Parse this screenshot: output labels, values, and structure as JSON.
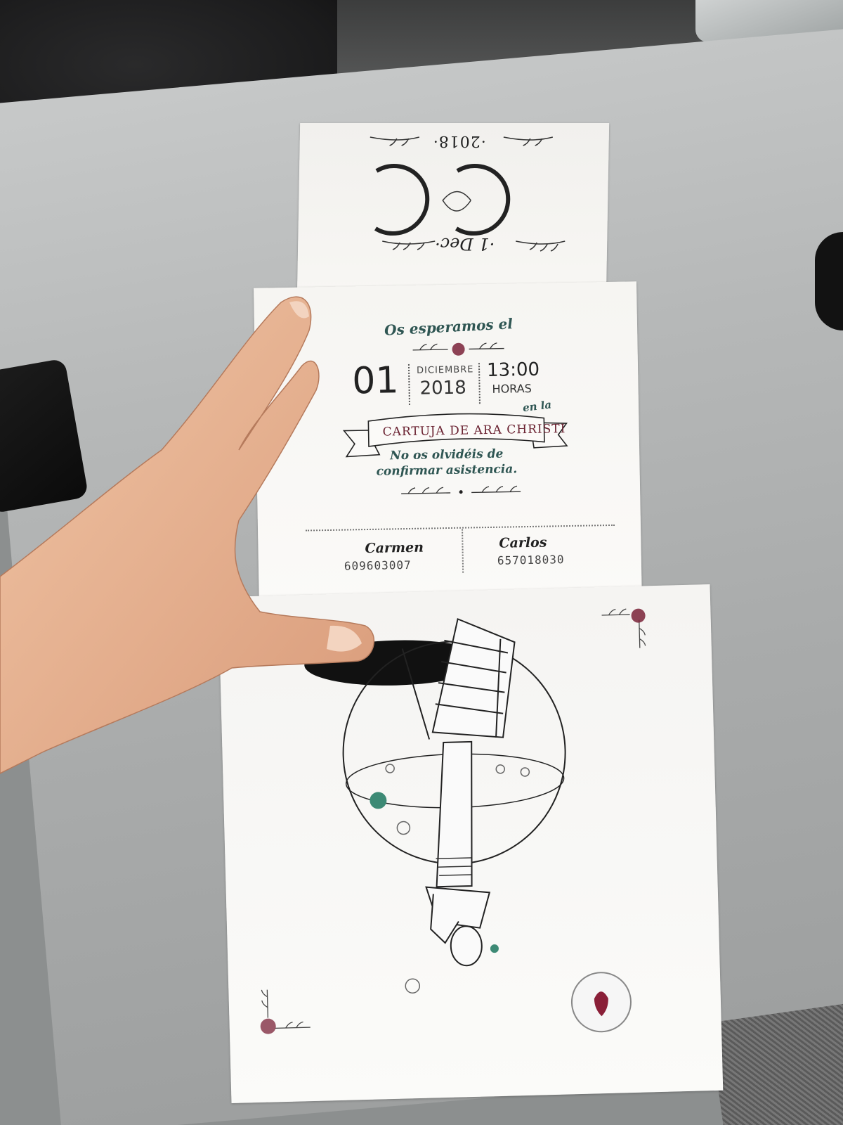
{
  "monogram_panel": {
    "year": "·2018·",
    "letters": "CC",
    "date_short": "·1 Dec·"
  },
  "details_panel": {
    "heading": "Os esperamos el",
    "day": "01",
    "month": "DICIEMBRE",
    "year": "2018",
    "time": "13:00",
    "time_unit": "HORAS",
    "connector": "en la",
    "venue": "CARTUJA DE ARA CHRISTI",
    "reminder_line1": "No os olvidéis de",
    "reminder_line2": "confirmar asistencia."
  },
  "contacts": [
    {
      "name": "Carmen",
      "phone": "609603007"
    },
    {
      "name": "Carlos",
      "phone": "657018030"
    }
  ],
  "colors": {
    "teal": "#2f5653",
    "burgundy": "#7a2238",
    "ink": "#222222",
    "paper": "#f7f6f3"
  }
}
